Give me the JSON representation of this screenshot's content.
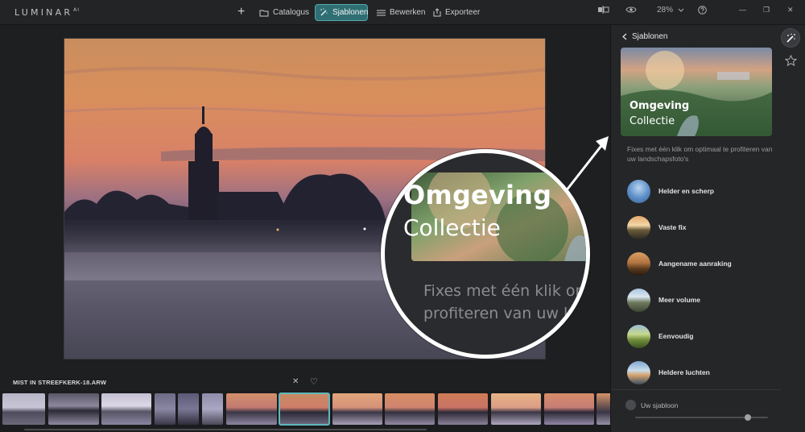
{
  "app": {
    "logo": "LUMINAR",
    "logo_sup": "AI"
  },
  "topbar": {
    "add_label": "+",
    "catalog_label": "Catalogus",
    "templates_label": "Sjablonen",
    "edit_label": "Bewerken",
    "export_label": "Exporteer",
    "zoom_value": "28%",
    "minimize_label": "—",
    "restore_label": "❐",
    "close_label": "✕"
  },
  "magnifier": {
    "title_line1": "Omgeving",
    "title_line2": "Collectie",
    "desc_line1": "Fixes met één klik om",
    "desc_line2": "profiteren van uw l"
  },
  "filmstrip": {
    "file_name": "MIST IN STREEFKERK-18.ARW",
    "close_label": "✕",
    "favorite_label": "♡"
  },
  "panel": {
    "back_label": "Sjablonen",
    "hero_line1": "Omgeving",
    "hero_line2": "Collectie",
    "description": "Fixes met één klik om optimaal te profiteren van uw landschapsfoto's",
    "presets": [
      {
        "label": "Helder en scherp"
      },
      {
        "label": "Vaste fix"
      },
      {
        "label": "Aangename aanraking"
      },
      {
        "label": "Meer volume"
      },
      {
        "label": "Eenvoudig"
      },
      {
        "label": "Heldere luchten"
      }
    ],
    "own_template_label": "Uw sjabloon",
    "own_template_amount": 0.85
  },
  "colors": {
    "accent": "#2f6f73",
    "accent_border": "#52a9ad",
    "selected_thumb": "#5fb8bc"
  }
}
